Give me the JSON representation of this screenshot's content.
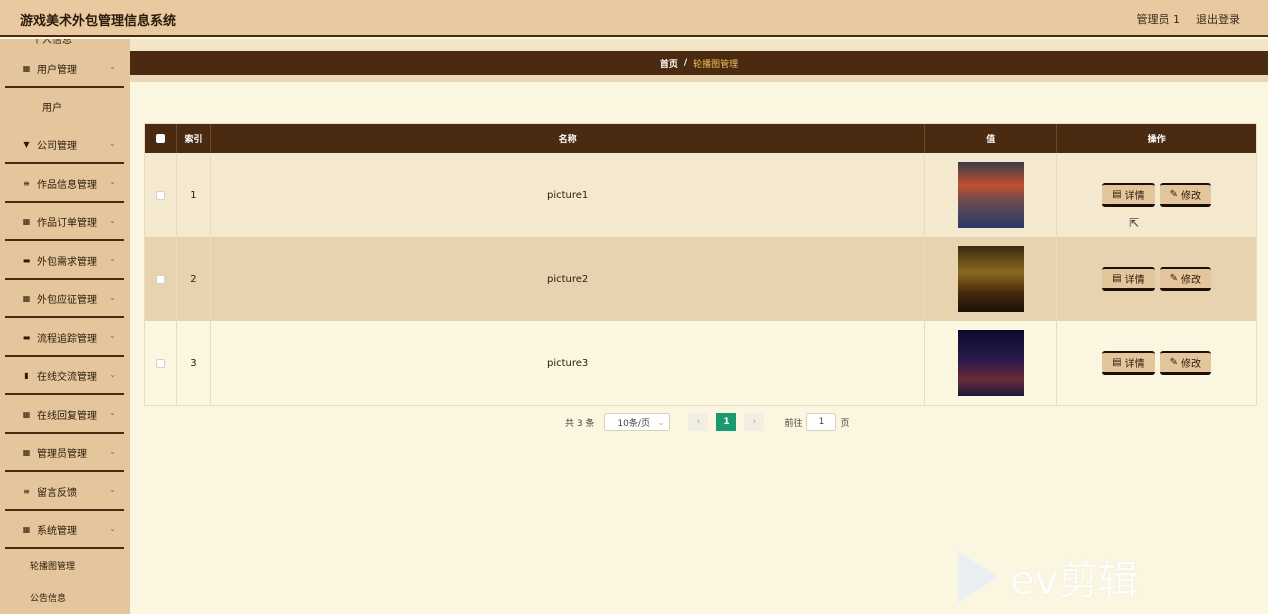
{
  "header": {
    "title": "游戏美术外包管理信息系统",
    "user": "管理员 1",
    "logout": "退出登录"
  },
  "sidebar": {
    "top_item": "个人信息",
    "groups": [
      {
        "label": "用户管理",
        "icon": "grid-icon",
        "children": [
          "用户"
        ]
      },
      {
        "label": "公司管理",
        "icon": "pin-icon",
        "children": []
      },
      {
        "label": "作品信息管理",
        "icon": "list-icon",
        "children": []
      },
      {
        "label": "作品订单管理",
        "icon": "table-icon",
        "children": []
      },
      {
        "label": "外包需求管理",
        "icon": "monitor-icon",
        "children": []
      },
      {
        "label": "外包应征管理",
        "icon": "grid-icon",
        "children": []
      },
      {
        "label": "流程追踪管理",
        "icon": "monitor-icon",
        "children": []
      },
      {
        "label": "在线交流管理",
        "icon": "bar-chart-icon",
        "children": []
      },
      {
        "label": "在线回复管理",
        "icon": "grid-icon",
        "children": []
      },
      {
        "label": "管理员管理",
        "icon": "grid-icon",
        "children": []
      },
      {
        "label": "留言反馈",
        "icon": "list-icon",
        "children": []
      },
      {
        "label": "系统管理",
        "icon": "grid-icon",
        "children": [
          "轮播图管理",
          "公告信息"
        ]
      }
    ]
  },
  "breadcrumb": {
    "home": "首页",
    "separator": "/",
    "current": "轮播图管理"
  },
  "table": {
    "columns": [
      "索引",
      "名称",
      "值",
      "操作"
    ],
    "rows": [
      {
        "index": "1",
        "name": "picture1"
      },
      {
        "index": "2",
        "name": "picture2"
      },
      {
        "index": "3",
        "name": "picture3"
      }
    ],
    "actions": {
      "detail": "详情",
      "edit": "修改"
    }
  },
  "pagination": {
    "total": "共 3 条",
    "page_size": "10条/页",
    "current_page": "1",
    "goto_label": "前往",
    "goto_value": "1",
    "page_unit": "页"
  },
  "watermark": "ev剪辑",
  "colors": {
    "primary_dark": "#4a2a10",
    "sidebar_bg": "#e5c59b",
    "content_bg": "#fbf6df",
    "active_page": "#1a9a70"
  }
}
